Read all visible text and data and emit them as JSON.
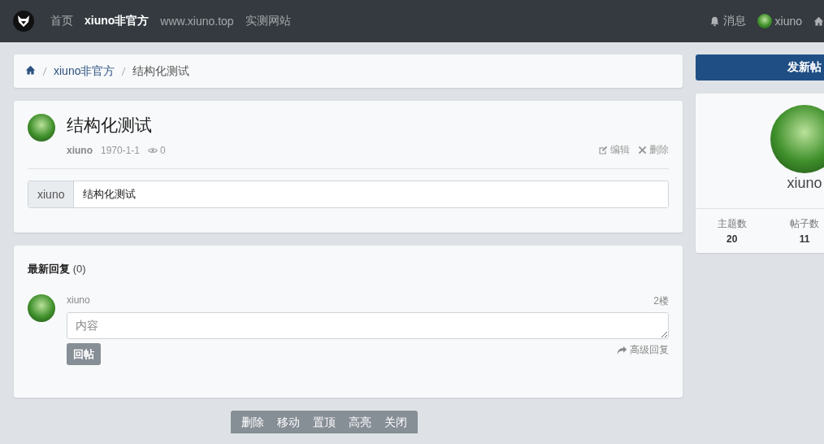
{
  "navbar": {
    "links": [
      {
        "label": "首页",
        "selected": false
      },
      {
        "label": "xiuno非官方",
        "selected": true
      },
      {
        "label": "www.xiuno.top",
        "selected": false
      },
      {
        "label": "实测网站",
        "selected": false
      }
    ],
    "right": [
      {
        "kind": "bell",
        "label": "消息"
      },
      {
        "kind": "avatar",
        "label": "xiuno"
      },
      {
        "kind": "home"
      }
    ]
  },
  "breadcrumb": [
    "xiuno非官方",
    "结构化测试"
  ],
  "thread": {
    "title": "结构化测试",
    "author": "xiuno",
    "date": "1970-1-1",
    "views": "0",
    "actions": [
      {
        "kind": "edit",
        "label": "编辑"
      },
      {
        "kind": "delete",
        "label": "删除"
      }
    ],
    "field": {
      "label": "xiuno",
      "value": "结构化测试"
    }
  },
  "replies": {
    "heading": "最新回复",
    "count": "(0)",
    "user": "xiuno",
    "floor": "2楼",
    "placeholder": "内容",
    "submit": "回帖",
    "advanced": "高级回复"
  },
  "sidebar": {
    "button": "发新帖",
    "username": "xiuno",
    "stats": [
      {
        "label": "主题数",
        "value": "20"
      },
      {
        "label": "帖子数",
        "value": "11"
      }
    ]
  },
  "mod_toolbar": [
    "删除",
    "移动",
    "置顶",
    "高亮",
    "关闭"
  ]
}
